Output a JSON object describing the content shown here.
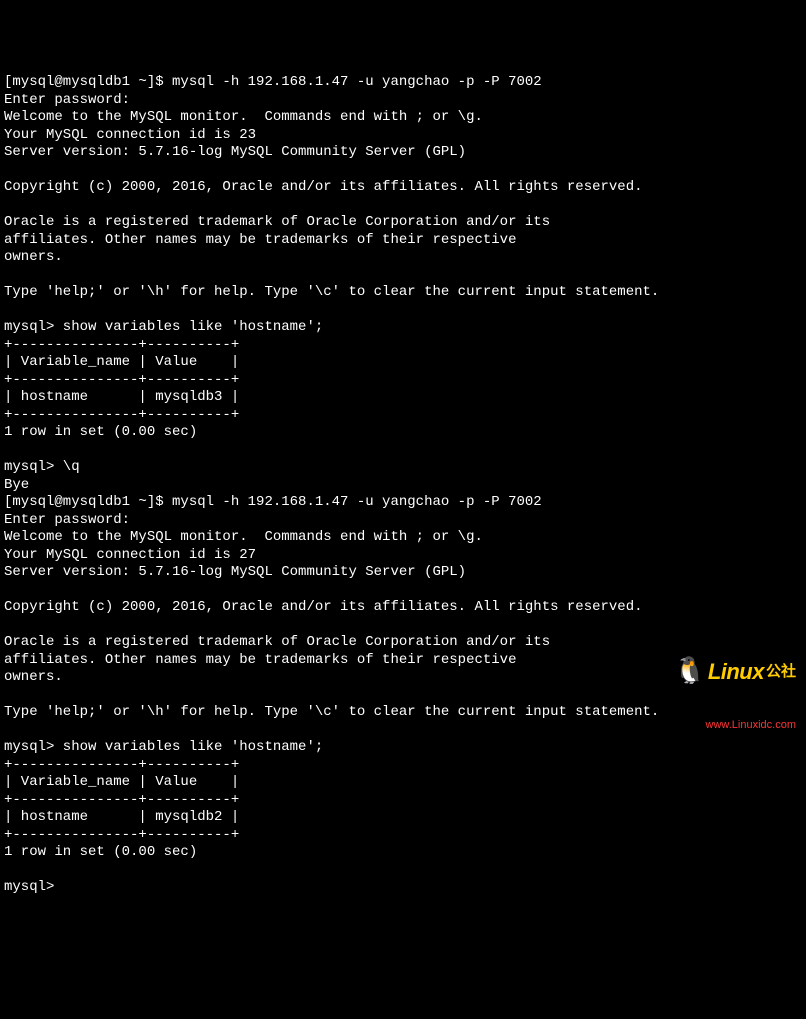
{
  "session1": {
    "prompt1": "[mysql@mysqldb1 ~]$ mysql -h 192.168.1.47 -u yangchao -p -P 7002",
    "enter_pw": "Enter password:",
    "welcome": "Welcome to the MySQL monitor.  Commands end with ; or \\g.",
    "conn_id": "Your MySQL connection id is 23",
    "server_ver": "Server version: 5.7.16-log MySQL Community Server (GPL)",
    "copyright": "Copyright (c) 2000, 2016, Oracle and/or its affiliates. All rights reserved.",
    "trademark1": "Oracle is a registered trademark of Oracle Corporation and/or its",
    "trademark2": "affiliates. Other names may be trademarks of their respective",
    "trademark3": "owners.",
    "help": "Type 'help;' or '\\h' for help. Type '\\c' to clear the current input statement.",
    "query": "mysql> show variables like 'hostname';",
    "tbl_border": "+---------------+----------+",
    "tbl_header": "| Variable_name | Value    |",
    "tbl_row": "| hostname      | mysqldb3 |",
    "result": "1 row in set (0.00 sec)",
    "quit": "mysql> \\q",
    "bye": "Bye"
  },
  "session2": {
    "prompt1": "[mysql@mysqldb1 ~]$ mysql -h 192.168.1.47 -u yangchao -p -P 7002",
    "enter_pw": "Enter password:",
    "welcome": "Welcome to the MySQL monitor.  Commands end with ; or \\g.",
    "conn_id": "Your MySQL connection id is 27",
    "server_ver": "Server version: 5.7.16-log MySQL Community Server (GPL)",
    "copyright": "Copyright (c) 2000, 2016, Oracle and/or its affiliates. All rights reserved.",
    "trademark1": "Oracle is a registered trademark of Oracle Corporation and/or its",
    "trademark2": "affiliates. Other names may be trademarks of their respective",
    "trademark3": "owners.",
    "help": "Type 'help;' or '\\h' for help. Type '\\c' to clear the current input statement.",
    "query": "mysql> show variables like 'hostname';",
    "tbl_border": "+---------------+----------+",
    "tbl_header": "| Variable_name | Value    |",
    "tbl_row": "| hostname      | mysqldb2 |",
    "result": "1 row in set (0.00 sec)",
    "prompt_end": "mysql>"
  },
  "watermark": {
    "brand": "Linux",
    "brand_cn": "公社",
    "url": "www.Linuxidc.com"
  }
}
